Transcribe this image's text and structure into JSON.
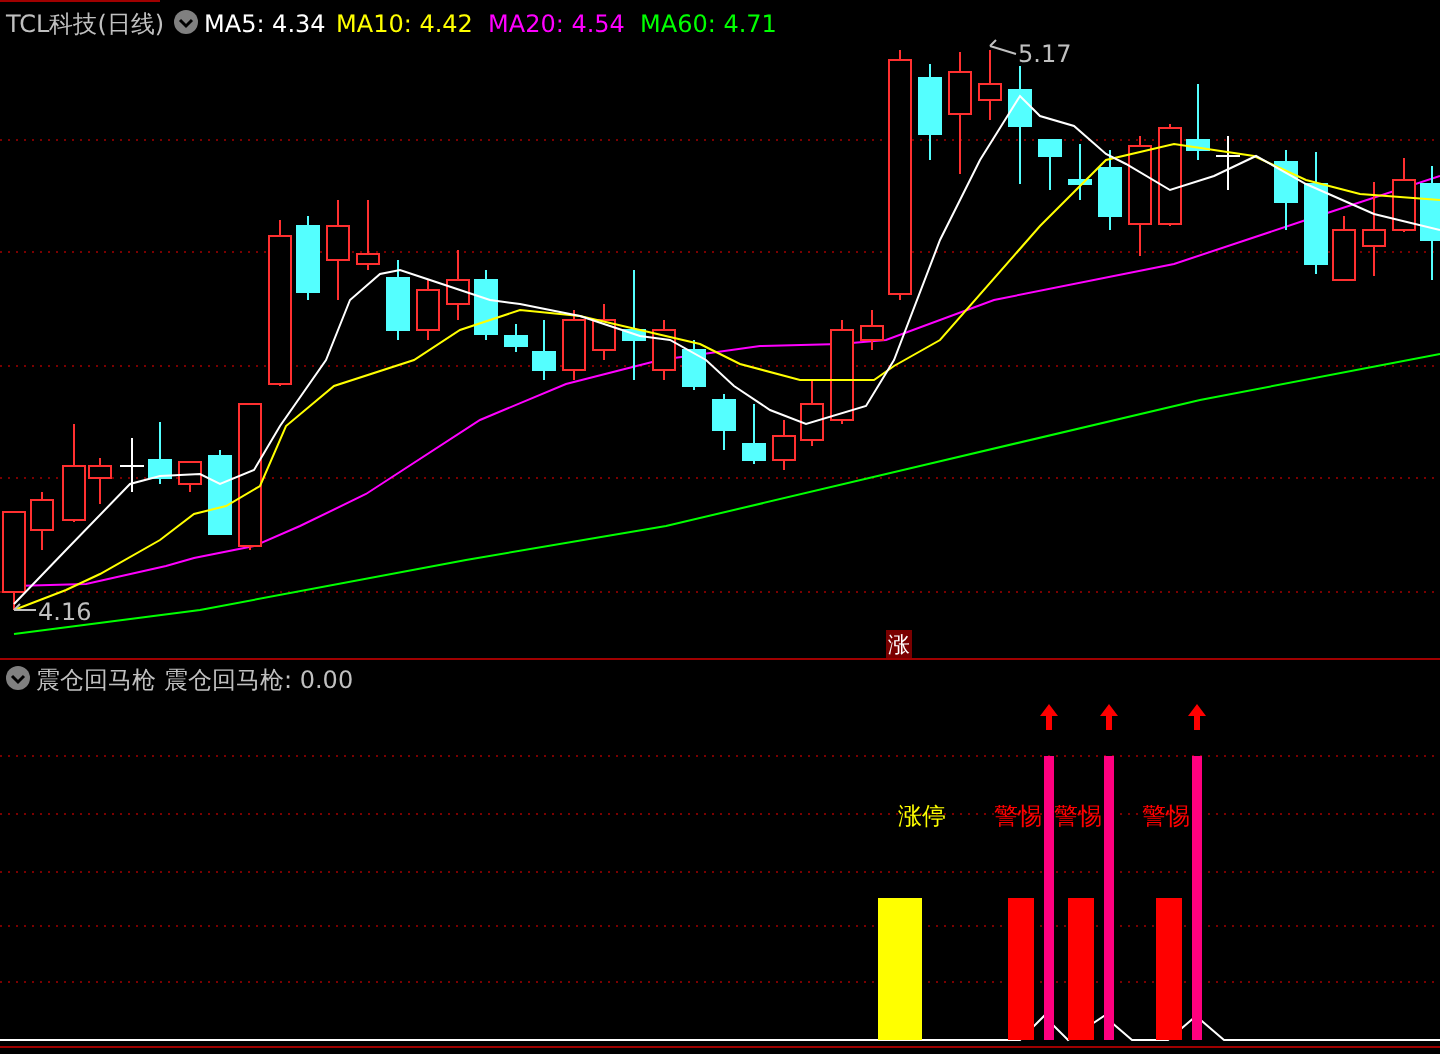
{
  "header": {
    "title": "TCL科技(日线)",
    "indicators": [
      {
        "label": "MA5: 4.34",
        "color": "#ffffff"
      },
      {
        "label": "MA10: 4.42",
        "color": "#ffff00"
      },
      {
        "label": "MA20: 4.54",
        "color": "#ff00ff"
      },
      {
        "label": "MA60: 4.71",
        "color": "#00ff00"
      }
    ]
  },
  "price_chart": {
    "high_label": "5.17",
    "low_label": "4.16",
    "limit_up_badge": "涨"
  },
  "indicator_panel": {
    "name": "震仓回马枪",
    "reading": "震仓回马枪: 0.00",
    "signals": [
      {
        "kind": "limit_up",
        "label": "涨停"
      },
      {
        "kind": "warning",
        "label": "警惕"
      },
      {
        "kind": "warning",
        "label": "警惕"
      },
      {
        "kind": "warning",
        "label": "警惕"
      }
    ]
  }
}
